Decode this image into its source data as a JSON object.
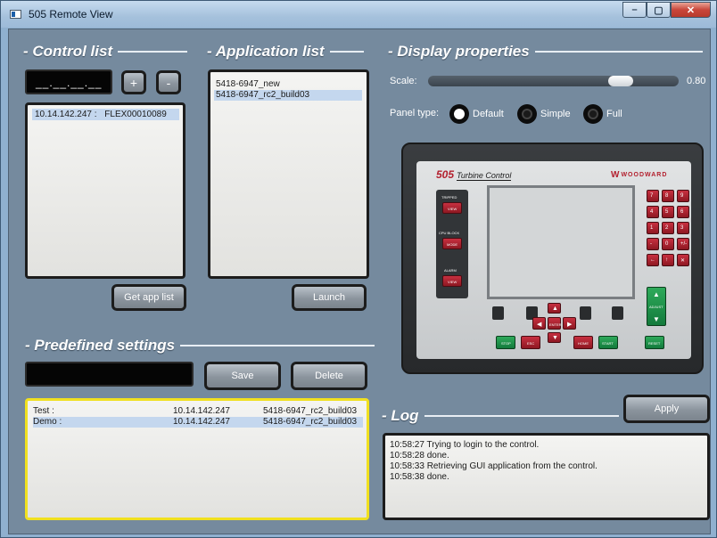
{
  "window": {
    "title": "505 Remote View",
    "minimize": "–",
    "maximize": "▢",
    "close": "✕"
  },
  "control_list": {
    "heading": "- Control list",
    "ip_placeholder": "__.__.__.__",
    "add": "+",
    "remove": "-",
    "items": [
      {
        "ip": "10.14.142.247 :",
        "name": "FLEX00010089"
      }
    ],
    "get_app_list": "Get app list"
  },
  "application_list": {
    "heading": "- Application list",
    "items": [
      "5418-6947_new",
      "5418-6947_rc2_build03"
    ],
    "launch": "Launch"
  },
  "display_properties": {
    "heading": "- Display properties",
    "scale_label": "Scale:",
    "scale_value": "0.80",
    "scale_fraction": 0.8,
    "panel_type_label": "Panel type:",
    "panel_types": [
      "Default",
      "Simple",
      "Full"
    ],
    "panel_type_selected": "Default"
  },
  "device": {
    "brand": "505",
    "product": "Turbine Control",
    "maker": "WOODWARD",
    "left_labels": [
      "TRIPPED",
      "VIEW",
      "CPU  BLOCK",
      "MODE",
      "ALARM",
      "VIEW"
    ],
    "enter": "ENTER",
    "bottom_keys": [
      "STOP",
      "ESC",
      "HOME",
      "START",
      "RESET"
    ],
    "adjust": "ADJUST",
    "keypad": [
      "7",
      "8",
      "9",
      "4",
      "5",
      "6",
      "1",
      "2",
      "3",
      "-",
      "0",
      "+/-",
      "←",
      "↑",
      "✕"
    ]
  },
  "predefined_settings": {
    "heading": "- Predefined settings",
    "save": "Save",
    "delete": "Delete",
    "rows": [
      {
        "name": "Test :",
        "ip": "10.14.142.247",
        "app": "5418-6947_rc2_build03"
      },
      {
        "name": "Demo :",
        "ip": "10.14.142.247",
        "app": "5418-6947_rc2_build03"
      }
    ]
  },
  "log": {
    "heading": "- Log",
    "apply": "Apply",
    "lines": [
      "10:58:27 Trying to login to the control.",
      "10:58:28 done.",
      "10:58:33 Retrieving GUI application from the control.",
      "10:58:38 done."
    ]
  },
  "colors": {
    "window_bg": "#758a9e",
    "selection": "#c4d7ee",
    "selected_frame": "#f0e020",
    "device_red": "#b3202e",
    "device_green": "#1e8f47"
  }
}
